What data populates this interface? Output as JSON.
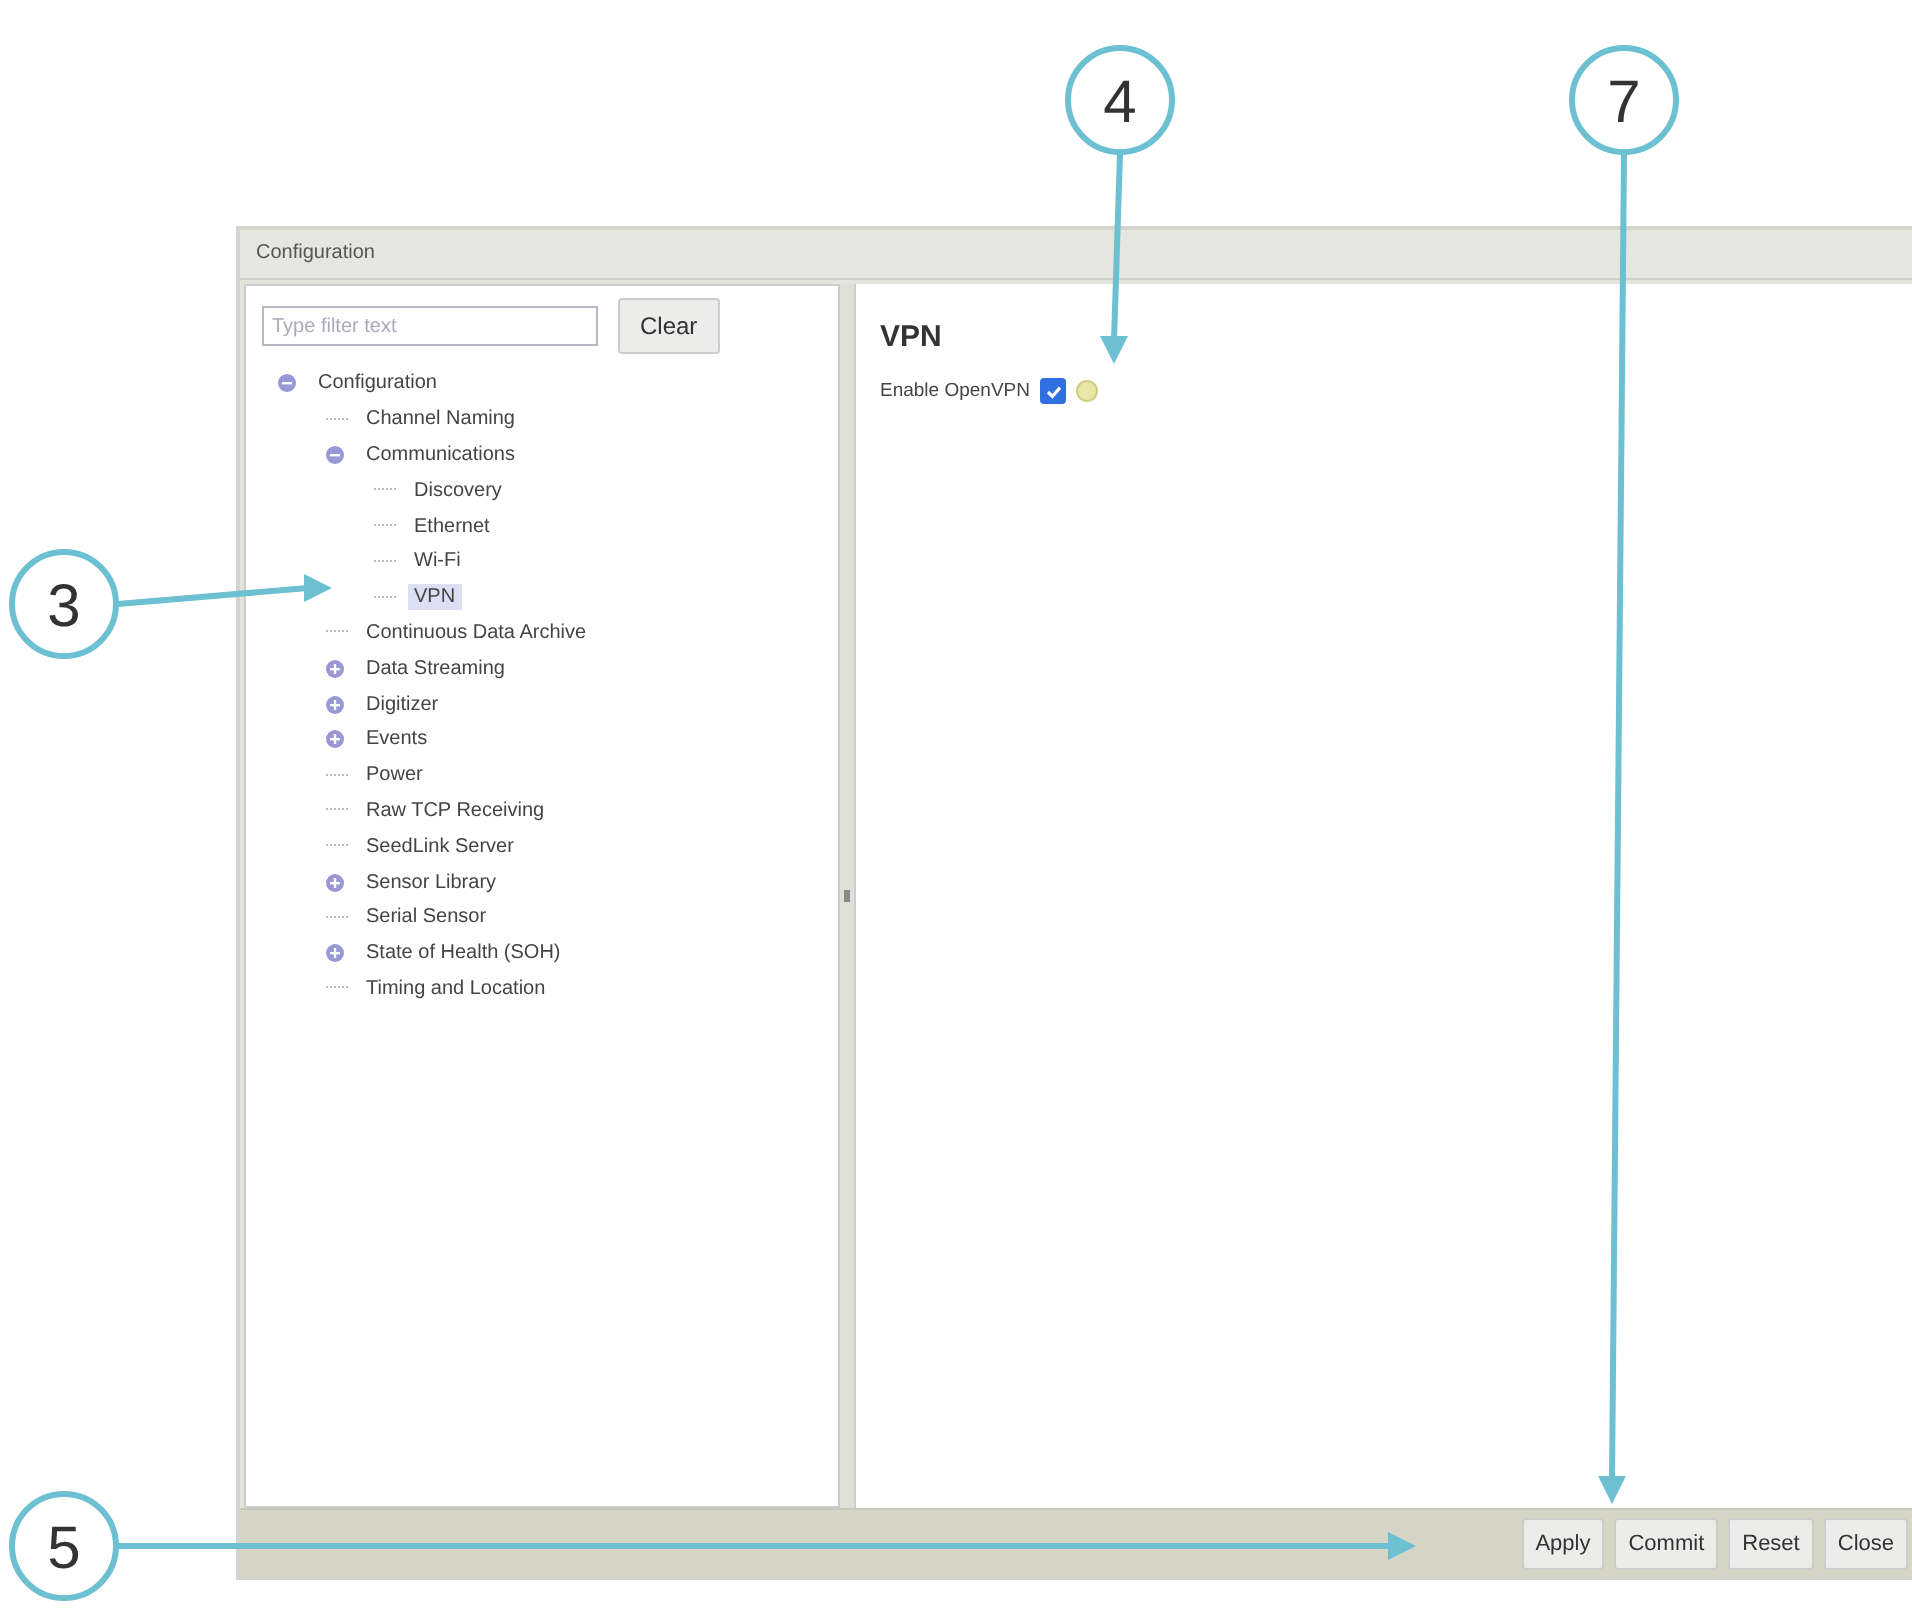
{
  "window": {
    "title": "Configuration"
  },
  "filter": {
    "placeholder": "Type filter text",
    "clear_button": "Clear"
  },
  "tree": [
    {
      "label": "Configuration",
      "expanded": true,
      "selected": false,
      "children": [
        {
          "label": "Channel Naming",
          "selected": false
        },
        {
          "label": "Communications",
          "expanded": true,
          "selected": false,
          "children": [
            {
              "label": "Discovery",
              "selected": false
            },
            {
              "label": "Ethernet",
              "selected": false
            },
            {
              "label": "Wi-Fi",
              "selected": false
            },
            {
              "label": "VPN",
              "selected": true
            }
          ]
        },
        {
          "label": "Continuous Data Archive",
          "selected": false
        },
        {
          "label": "Data Streaming",
          "expanded": false,
          "selected": false
        },
        {
          "label": "Digitizer",
          "expanded": false,
          "selected": false
        },
        {
          "label": "Events",
          "expanded": false,
          "selected": false
        },
        {
          "label": "Power",
          "selected": false
        },
        {
          "label": "Raw TCP Receiving",
          "selected": false
        },
        {
          "label": "SeedLink Server",
          "selected": false
        },
        {
          "label": "Sensor Library",
          "expanded": false,
          "selected": false
        },
        {
          "label": "Serial Sensor",
          "selected": false
        },
        {
          "label": "State of Health (SOH)",
          "expanded": false,
          "selected": false
        },
        {
          "label": "Timing and Location",
          "selected": false
        }
      ]
    }
  ],
  "detail": {
    "heading": "VPN",
    "fields": [
      {
        "label": "Enable OpenVPN",
        "checked": true
      }
    ]
  },
  "footer_buttons": [
    "Apply",
    "Commit",
    "Reset",
    "Close"
  ],
  "callouts": [
    {
      "number": "4",
      "kind": "down"
    },
    {
      "number": "7",
      "kind": "down"
    },
    {
      "number": "3",
      "kind": "right"
    },
    {
      "number": "5",
      "kind": "right"
    }
  ]
}
